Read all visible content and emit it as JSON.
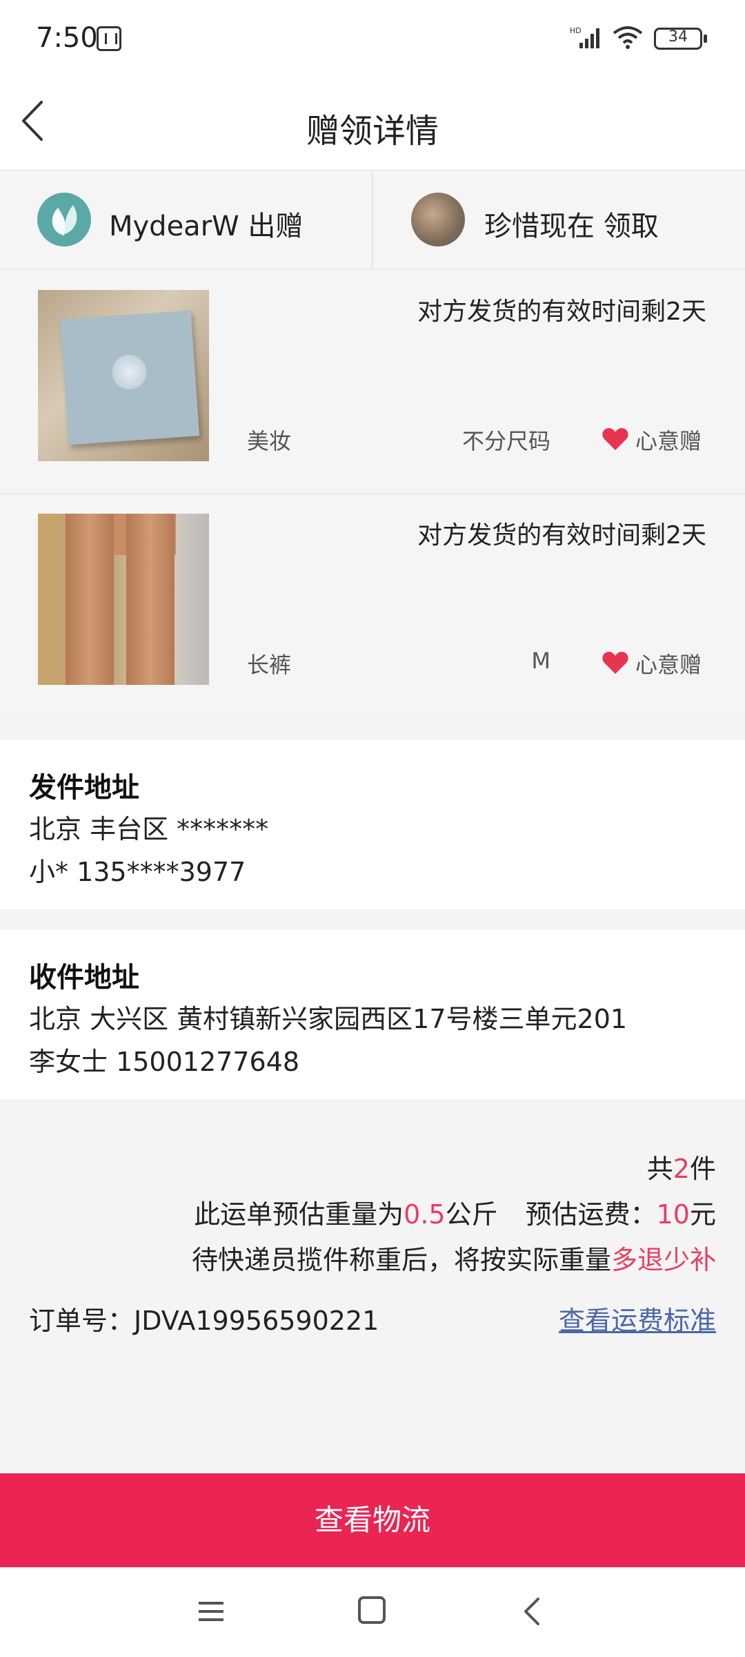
{
  "status_bar": {
    "time": "7:50",
    "battery": "34",
    "icons": [
      "nfc-icon",
      "signal-icon",
      "wifi-icon",
      "battery-icon"
    ]
  },
  "header": {
    "title": "赠领详情",
    "back_icon": "chevron-left-icon"
  },
  "parties": {
    "giver": "MydearW 出赠",
    "receiver": "珍惜现在 领取"
  },
  "items": [
    {
      "expire": "对方发货的有效时间剩2天",
      "category": "美妆",
      "size": "不分尺码",
      "gift_type": "心意赠"
    },
    {
      "expire": "对方发货的有效时间剩2天",
      "category": "长裤",
      "size": "M",
      "gift_type": "心意赠"
    }
  ],
  "sender_address": {
    "title": "发件地址",
    "line1": "北京 丰台区 *******",
    "line2": "小* 135****3977"
  },
  "receiver_address": {
    "title": "收件地址",
    "line1": "北京 大兴区 黄村镇新兴家园西区17号楼三单元201",
    "line2": "李女士 15001277648"
  },
  "summary": {
    "count_prefix": "共",
    "count": "2",
    "count_suffix": "件",
    "weight_prefix": "此运单预估重量为",
    "weight": "0.5",
    "weight_unit": "公斤",
    "fee_prefix": "预估运费：",
    "fee": "10",
    "fee_unit": "元",
    "note_prefix": "待快递员揽件称重后，将按实际重量",
    "note_highlight": "多退少补",
    "order_no": "订单号：JDVA19956590221",
    "fee_standard_link": "查看运费标准"
  },
  "action": {
    "logistics_button": "查看物流"
  },
  "colors": {
    "accent": "#ea2453",
    "highlight": "#e83d63",
    "link": "#4a67a8",
    "heart": "#e8344e"
  }
}
